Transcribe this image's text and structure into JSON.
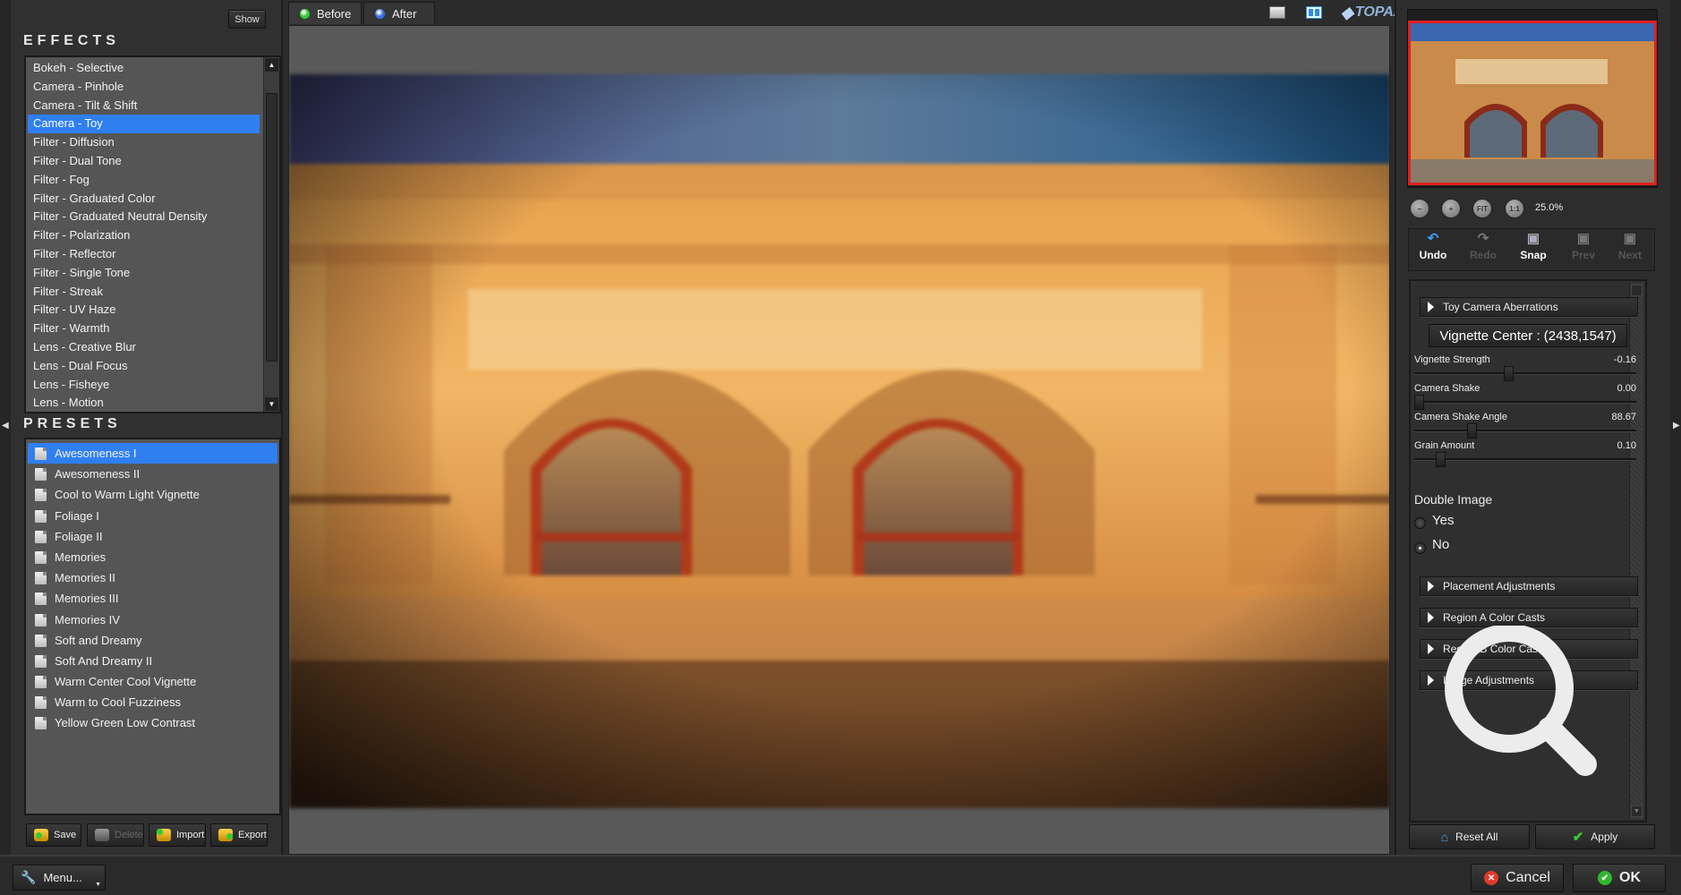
{
  "left_panel": {
    "show_button": "Show",
    "effects_title": "EFFECTS",
    "effects": [
      {
        "label": "Bokeh - Selective",
        "selected": false
      },
      {
        "label": "Camera - Pinhole",
        "selected": false
      },
      {
        "label": "Camera - Tilt & Shift",
        "selected": false
      },
      {
        "label": "Camera - Toy",
        "selected": true
      },
      {
        "label": "Filter - Diffusion",
        "selected": false
      },
      {
        "label": "Filter - Dual Tone",
        "selected": false
      },
      {
        "label": "Filter - Fog",
        "selected": false
      },
      {
        "label": "Filter - Graduated Color",
        "selected": false
      },
      {
        "label": "Filter - Graduated Neutral Density",
        "selected": false
      },
      {
        "label": "Filter - Polarization",
        "selected": false
      },
      {
        "label": "Filter - Reflector",
        "selected": false
      },
      {
        "label": "Filter - Single Tone",
        "selected": false
      },
      {
        "label": "Filter - Streak",
        "selected": false
      },
      {
        "label": "Filter - UV Haze",
        "selected": false
      },
      {
        "label": "Filter - Warmth",
        "selected": false
      },
      {
        "label": "Lens - Creative Blur",
        "selected": false
      },
      {
        "label": "Lens - Dual Focus",
        "selected": false
      },
      {
        "label": "Lens - Fisheye",
        "selected": false
      },
      {
        "label": "Lens - Motion",
        "selected": false
      }
    ],
    "presets_title": "PRESETS",
    "presets": [
      {
        "label": "Awesomeness I",
        "selected": true
      },
      {
        "label": "Awesomeness II",
        "selected": false
      },
      {
        "label": "Cool to Warm Light Vignette",
        "selected": false
      },
      {
        "label": "Foliage I",
        "selected": false
      },
      {
        "label": "Foliage II",
        "selected": false
      },
      {
        "label": "Memories",
        "selected": false
      },
      {
        "label": "Memories II",
        "selected": false
      },
      {
        "label": "Memories III",
        "selected": false
      },
      {
        "label": "Memories IV",
        "selected": false
      },
      {
        "label": "Soft and Dreamy",
        "selected": false
      },
      {
        "label": "Soft And Dreamy II",
        "selected": false
      },
      {
        "label": "Warm Center Cool Vignette",
        "selected": false
      },
      {
        "label": "Warm to Cool Fuzziness",
        "selected": false
      },
      {
        "label": "Yellow Green Low Contrast",
        "selected": false
      }
    ],
    "buttons": {
      "save": "Save",
      "delete": "Delete",
      "import": "Import",
      "export": "Export"
    }
  },
  "top_bar": {
    "tabs": [
      {
        "label": "Before",
        "led_color": "#33cc33",
        "active": true
      },
      {
        "label": "After",
        "led_color": "#3a6fe0",
        "active": false
      }
    ],
    "logo": "TOPAZ"
  },
  "right_panel": {
    "zoom": {
      "out": "−",
      "in": "+",
      "fit": "FIT",
      "one_to_one": "1:1",
      "level": "25.0%"
    },
    "history": {
      "undo": "Undo",
      "redo": "Redo",
      "snap": "Snap",
      "prev": "Prev",
      "next": "Next"
    },
    "group_toy": "Toy Camera Aberrations",
    "vignette_center": "Vignette Center : (2438,1547)",
    "sliders": [
      {
        "label": "Vignette Strength",
        "value": "-0.16",
        "fraction": 0.42
      },
      {
        "label": "Camera Shake",
        "value": "0.00",
        "fraction": 0.0
      },
      {
        "label": "Camera Shake Angle",
        "value": "88.67",
        "fraction": 0.25
      },
      {
        "label": "Grain Amount",
        "value": "0.10",
        "fraction": 0.1
      }
    ],
    "double_image": {
      "title": "Double Image",
      "yes": "Yes",
      "no": "No",
      "selected": "No"
    },
    "groups": [
      "Placement Adjustments",
      "Region A Color Casts",
      "Region B Color Casts",
      "Image Adjustments"
    ],
    "reset_all": "Reset All",
    "apply": "Apply"
  },
  "footer": {
    "menu": "Menu...",
    "cancel": "Cancel",
    "ok": "OK"
  },
  "colors": {
    "selection": "#2f7ff0",
    "thumbnail_border": "#e02020"
  }
}
